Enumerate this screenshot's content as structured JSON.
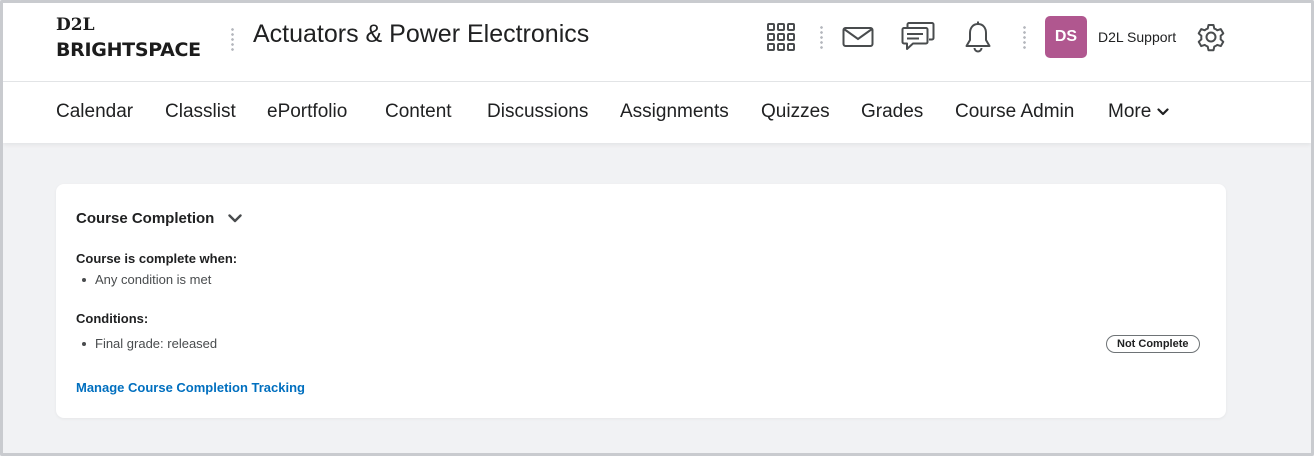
{
  "header": {
    "logo_top": "D2L",
    "logo_bottom": "BRIGHTSPACE",
    "course_title": "Actuators & Power Electronics",
    "icons": [
      "apps-grid-icon",
      "mail-icon",
      "chat-icon",
      "bell-icon",
      "gear-icon"
    ],
    "avatar_initials": "DS",
    "avatar_color": "#b0578f",
    "user_name": "D2L Support"
  },
  "nav": {
    "items": [
      {
        "label": "Calendar"
      },
      {
        "label": "Classlist"
      },
      {
        "label": "ePortfolio"
      },
      {
        "label": "Content"
      },
      {
        "label": "Discussions"
      },
      {
        "label": "Assignments"
      },
      {
        "label": "Quizzes"
      },
      {
        "label": "Grades"
      },
      {
        "label": "Course Admin"
      }
    ],
    "more_label": "More"
  },
  "completion": {
    "title": "Course Completion",
    "complete_when_label": "Course is complete when:",
    "complete_when_items": [
      "Any condition is met"
    ],
    "conditions_label": "Conditions:",
    "conditions": [
      {
        "text": "Final grade: released",
        "status": "Not Complete"
      }
    ],
    "manage_link": "Manage Course Completion Tracking",
    "link_color": "#006fbf"
  }
}
